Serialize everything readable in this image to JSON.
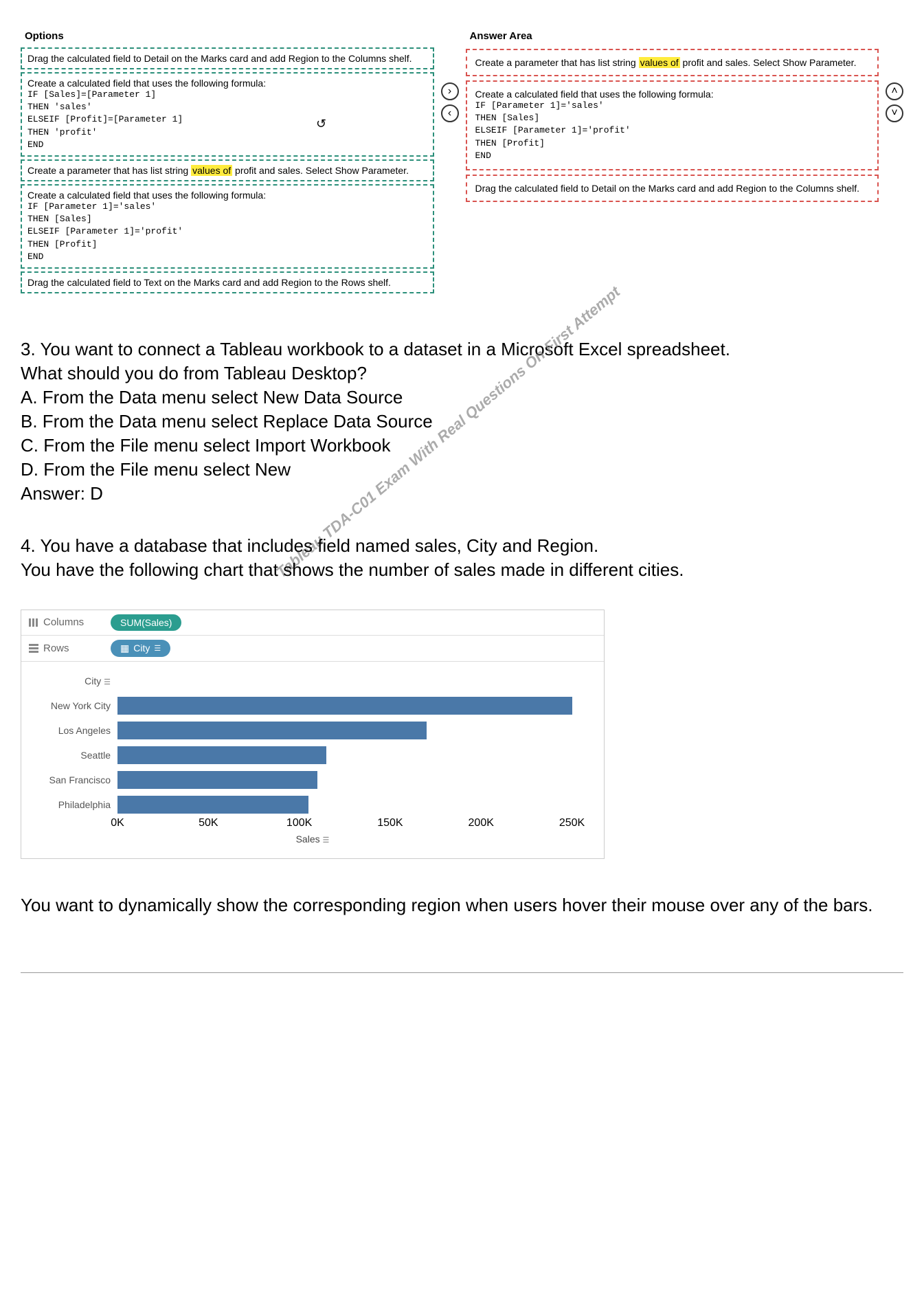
{
  "dragdrop": {
    "options_header": "Options",
    "answer_header": "Answer Area",
    "options": [
      {
        "text": "Drag the calculated field to Detail on the Marks card and add Region to the Columns shelf."
      },
      {
        "text_intro": "Create a calculated field that uses the following formula:",
        "formula": "IF [Sales]=[Parameter 1]\nTHEN 'sales'\nELSEIF [Profit]=[Parameter 1]\nTHEN 'profit'\nEND"
      },
      {
        "text_pre": "Create a parameter that has list string ",
        "hl": "values of",
        "text_post": " profit and sales. Select Show Parameter."
      },
      {
        "text_intro": "Create a calculated field that uses the following formula:",
        "formula": "IF [Parameter 1]='sales'\nTHEN [Sales]\nELSEIF [Parameter 1]='profit'\nTHEN [Profit]\nEND"
      },
      {
        "text": "Drag the calculated field to Text on the Marks card and add Region to the Rows shelf."
      }
    ],
    "answers": [
      {
        "text_pre": "Create a parameter that has list string ",
        "hl": "values of",
        "text_post": " profit and sales. Select Show Parameter."
      },
      {
        "text_intro": "Create a calculated field that uses the following formula:",
        "formula": "IF [Parameter 1]='sales'\nTHEN [Sales]\nELSEIF [Parameter 1]='profit'\nTHEN [Profit]\nEND"
      },
      {
        "text": "Drag the calculated field to Detail on the Marks card and add Region to the Columns shelf."
      }
    ]
  },
  "q3": {
    "stem_a": "3. You want to connect a Tableau workbook to a dataset in a Microsoft Excel spreadsheet.",
    "stem_b": "What should you do from Tableau Desktop?",
    "opt_a": "A. From the Data menu select New Data Source",
    "opt_b": "B. From the Data menu select Replace Data Source",
    "opt_c": "C. From the File menu select Import Workbook",
    "opt_d": "D. From the File menu select New",
    "answer": "Answer: D"
  },
  "watermark_text": "Tableau TDA-C01 Exam With Real Questions On First Attempt",
  "q4": {
    "stem_a": "4. You have a database that includes field named sales, City and Region.",
    "stem_b": "You have the following chart that shows the number of sales made in different cities."
  },
  "tableau": {
    "columns_label": "Columns",
    "rows_label": "Rows",
    "pill_columns": "SUM(Sales)",
    "pill_rows": "City",
    "y_header": "City",
    "x_title": "Sales"
  },
  "chart_data": {
    "type": "bar",
    "categories": [
      "New York City",
      "Los Angeles",
      "Seattle",
      "San Francisco",
      "Philadelphia"
    ],
    "values": [
      250000,
      170000,
      115000,
      110000,
      105000
    ],
    "xlabel": "Sales",
    "ylabel": "City",
    "xlim": [
      0,
      260000
    ],
    "xticks": [
      0,
      50000,
      100000,
      150000,
      200000,
      250000
    ],
    "xtick_labels": [
      "0K",
      "50K",
      "100K",
      "150K",
      "200K",
      "250K"
    ]
  },
  "footer_q": "You want to dynamically show the corresponding region when users hover their mouse over any of the bars."
}
